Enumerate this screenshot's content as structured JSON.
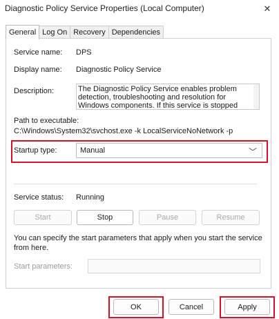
{
  "window": {
    "title": "Diagnostic Policy Service Properties (Local Computer)",
    "close_glyph": "✕"
  },
  "tabs": [
    {
      "label": "General",
      "active": true
    },
    {
      "label": "Log On",
      "active": false
    },
    {
      "label": "Recovery",
      "active": false
    },
    {
      "label": "Dependencies",
      "active": false
    }
  ],
  "general": {
    "service_name_label": "Service name:",
    "service_name_value": "DPS",
    "display_name_label": "Display name:",
    "display_name_value": "Diagnostic Policy Service",
    "description_label": "Description:",
    "description_value": "The Diagnostic Policy Service enables problem detection, troubleshooting and resolution for Windows components.  If this service is stopped",
    "path_label": "Path to executable:",
    "path_value": "C:\\Windows\\System32\\svchost.exe -k LocalServiceNoNetwork -p",
    "startup_type_label": "Startup type:",
    "startup_type_value": "Manual",
    "service_status_label": "Service status:",
    "service_status_value": "Running",
    "buttons": {
      "start": "Start",
      "stop": "Stop",
      "pause": "Pause",
      "resume": "Resume"
    },
    "start_params_hint": "You can specify the start parameters that apply when you start the service from here.",
    "start_params_label": "Start parameters:",
    "start_params_value": ""
  },
  "footer": {
    "ok": "OK",
    "cancel": "Cancel",
    "apply": "Apply"
  },
  "colors": {
    "highlight": "#d0122a"
  }
}
